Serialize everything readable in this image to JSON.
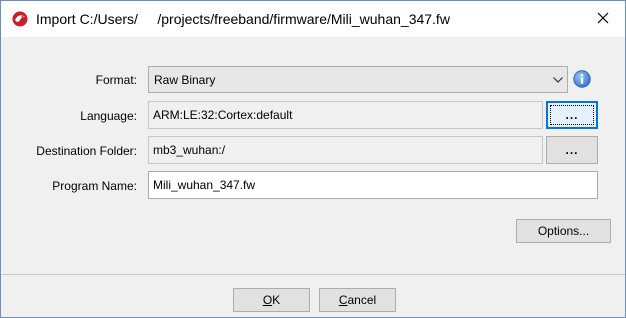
{
  "window": {
    "title": "Import C:/Users/     /projects/freeband/firmware/Mili_wuhan_347.fw",
    "app_icon": "dragon-icon",
    "close_icon": "close-icon"
  },
  "form": {
    "format": {
      "label": "Format:",
      "value": "Raw Binary",
      "info_icon": "info-icon"
    },
    "language": {
      "label": "Language:",
      "value": "ARM:LE:32:Cortex:default",
      "browse_label": "..."
    },
    "destination": {
      "label": "Destination Folder:",
      "value": "mb3_wuhan:/",
      "browse_label": "..."
    },
    "program_name": {
      "label": "Program Name:",
      "value": "Mili_wuhan_347.fw"
    },
    "options_label": "Options..."
  },
  "footer": {
    "ok_mnemonic": "O",
    "ok_rest": "K",
    "cancel_mnemonic": "C",
    "cancel_rest": "ancel"
  },
  "colors": {
    "accent": "#0078d7",
    "info": "#3a7fd5",
    "app_icon": "#c8202a"
  }
}
